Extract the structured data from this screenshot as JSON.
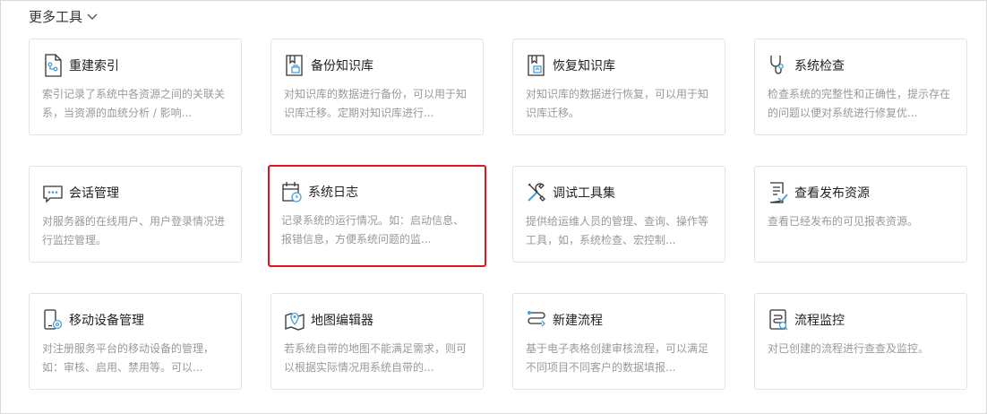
{
  "section": {
    "title": "更多工具"
  },
  "colors": {
    "accent": "#4a9fd9",
    "selected_border": "#e0141c",
    "title": "#222222",
    "desc": "#999999"
  },
  "tools": [
    {
      "title": "重建索引",
      "icon": "index-doc-icon",
      "desc": "索引记录了系统中各资源之间的关联关系，当资源的血统分析 / 影响..."
    },
    {
      "title": "备份知识库",
      "icon": "backup-book-icon",
      "desc": "对知识库的数据进行备份，可以用于知识库迁移。定期对知识库进行..."
    },
    {
      "title": "恢复知识库",
      "icon": "restore-book-icon",
      "desc": "对知识库的数据进行恢复，可以用于知识库迁移。"
    },
    {
      "title": "系统检查",
      "icon": "stethoscope-icon",
      "desc": "检查系统的完整性和正确性，提示存在的问题以便对系统进行修复优..."
    },
    {
      "title": "会话管理",
      "icon": "chat-bubble-icon",
      "desc": "对服务器的在线用户、用户登录情况进行监控管理。"
    },
    {
      "title": "系统日志",
      "icon": "calendar-clock-icon",
      "desc": "记录系统的运行情况。如：启动信息、报错信息，方便系统问题的监..."
    },
    {
      "title": "调试工具集",
      "icon": "tools-icon",
      "desc": "提供给运维人员的管理、查询、操作等工具，如，系统检查、宏控制..."
    },
    {
      "title": "查看发布资源",
      "icon": "doc-check-icon",
      "desc": "查看已经发布的可见报表资源。"
    },
    {
      "title": "移动设备管理",
      "icon": "mobile-gear-icon",
      "desc": "对注册服务平台的移动设备的管理，如：审核、启用、禁用等。可以..."
    },
    {
      "title": "地图编辑器",
      "icon": "map-pin-icon",
      "desc": "若系统自带的地图不能满足需求，则可以根据实际情况用系统自带的..."
    },
    {
      "title": "新建流程",
      "icon": "flow-new-icon",
      "desc": "基于电子表格创建审核流程，可以满足不同项目不同客户的数据填报..."
    },
    {
      "title": "流程监控",
      "icon": "flow-monitor-icon",
      "desc": "对已创建的流程进行查查及监控。"
    }
  ]
}
